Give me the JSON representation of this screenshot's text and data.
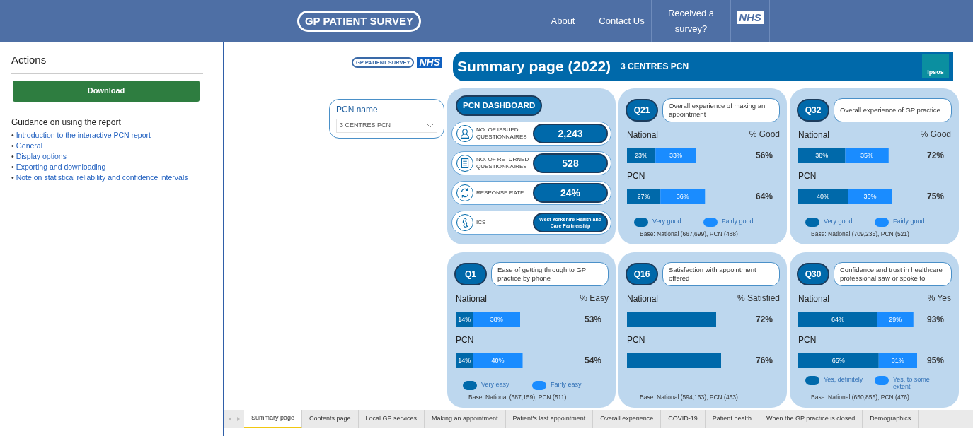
{
  "header": {
    "logo": "GP PATIENT SURVEY",
    "nav": [
      {
        "label": "About"
      },
      {
        "label": "Contact Us"
      },
      {
        "label": "Received a survey?"
      }
    ],
    "nhs_logo": "NHS"
  },
  "sidebar": {
    "title": "Actions",
    "download": "Download",
    "guidance_title": "Guidance on using the report",
    "links": [
      {
        "bullet": "•",
        "label": "Introduction to the interactive PCN report"
      },
      {
        "bullet": "•",
        "label": "General"
      },
      {
        "bullet": "•",
        "label": "Display options"
      },
      {
        "bullet": "•",
        "label": "Exporting and downloading"
      },
      {
        "bullet": "•",
        "label": "Note on statistical reliability and confidence intervals"
      }
    ]
  },
  "report": {
    "logo": "GP PATIENT SURVEY",
    "nhs_logo": "NHS",
    "title": "Summary page (2022)",
    "subtitle": "3 CENTRES PCN",
    "ipsos_logo": "Ipsos",
    "filter": {
      "label": "PCN name",
      "value": "3 CENTRES PCN"
    },
    "dashboard": {
      "title": "PCN DASHBOARD",
      "stats": [
        {
          "kind": "person",
          "label": "NO. OF ISSUED QUESTIONNAIRES",
          "value": "2,243"
        },
        {
          "kind": "document",
          "label": "NO. OF RETURNED QUESTIONNAIRES",
          "value": "528"
        },
        {
          "kind": "cycle",
          "label": "RESPONSE RATE",
          "value": "24%"
        },
        {
          "kind": "map",
          "label": "ICS",
          "value": "West Yorkshire Health and Care Partnership"
        }
      ]
    },
    "questions": [
      {
        "code": "Q21",
        "text": "Overall experience of making an appointment",
        "metric": "% Good",
        "totals": [
          "56%",
          "64%"
        ],
        "base": "Base: National (667,699), PCN (488)",
        "chart_data": {
          "type": "bar",
          "orientation": "horizontal",
          "stacked": true,
          "categories": [
            "National",
            "PCN"
          ],
          "series": [
            {
              "name": "Very good",
              "color": "#0069aa",
              "values": [
                23,
                27
              ],
              "value_labels": [
                "23%",
                "27%"
              ]
            },
            {
              "name": "Fairly good",
              "color": "#1a8cff",
              "values": [
                33,
                36
              ],
              "value_labels": [
                "33%",
                "36%"
              ]
            }
          ]
        }
      },
      {
        "code": "Q32",
        "text": "Overall experience of GP practice",
        "metric": "% Good",
        "totals": [
          "72%",
          "75%"
        ],
        "base": "Base: National (709,235), PCN (521)",
        "chart_data": {
          "type": "bar",
          "orientation": "horizontal",
          "stacked": true,
          "categories": [
            "National",
            "PCN"
          ],
          "series": [
            {
              "name": "Very good",
              "color": "#0069aa",
              "values": [
                38,
                40
              ],
              "value_labels": [
                "38%",
                "40%"
              ]
            },
            {
              "name": "Fairly good",
              "color": "#1a8cff",
              "values": [
                35,
                36
              ],
              "value_labels": [
                "35%",
                "36%"
              ]
            }
          ]
        }
      },
      {
        "code": "Q1",
        "text": "Ease of getting through to GP practice by phone",
        "metric": "% Easy",
        "totals": [
          "53%",
          "54%"
        ],
        "base": "Base: National (687,159), PCN (511)",
        "chart_data": {
          "type": "bar",
          "orientation": "horizontal",
          "stacked": true,
          "categories": [
            "National",
            "PCN"
          ],
          "series": [
            {
              "name": "Very easy",
              "color": "#0069aa",
              "values": [
                14,
                14
              ],
              "value_labels": [
                "14%",
                "14%"
              ]
            },
            {
              "name": "Fairly easy",
              "color": "#1a8cff",
              "values": [
                38,
                40
              ],
              "value_labels": [
                "38%",
                "40%"
              ]
            }
          ]
        }
      },
      {
        "code": "Q16",
        "text": "Satisfaction with appointment offered",
        "metric": "% Satisfied",
        "base": "Base: National (594,163), PCN (453)",
        "chart_data": {
          "type": "bar",
          "orientation": "horizontal",
          "stacked": true,
          "categories": [
            "National",
            "PCN"
          ],
          "series": [
            {
              "color": "#0069aa",
              "values": [
                72,
                76
              ],
              "value_labels": [
                "72%",
                "76%"
              ]
            }
          ]
        }
      },
      {
        "code": "Q30",
        "text": "Confidence and trust in healthcare professional saw or spoke to",
        "metric": "% Yes",
        "totals": [
          "93%",
          "95%"
        ],
        "base": "Base: National (650,855), PCN (476)",
        "chart_data": {
          "type": "bar",
          "orientation": "horizontal",
          "stacked": true,
          "categories": [
            "National",
            "PCN"
          ],
          "series": [
            {
              "name": "Yes, definitely",
              "color": "#0069aa",
              "values": [
                64,
                65
              ],
              "value_labels": [
                "64%",
                "65%"
              ]
            },
            {
              "name": "Yes, to some extent",
              "color": "#1a8cff",
              "values": [
                29,
                31
              ],
              "value_labels": [
                "29%",
                "31%"
              ]
            }
          ]
        }
      }
    ]
  },
  "tabs": [
    {
      "label": "Summary page",
      "selected": true
    },
    {
      "label": "Contents page",
      "selected": false
    },
    {
      "label": "Local GP services",
      "selected": false
    },
    {
      "label": "Making an appointment",
      "selected": false
    },
    {
      "label": "Patient's last appointment",
      "selected": false
    },
    {
      "label": "Overall experience",
      "selected": false
    },
    {
      "label": "COVID-19",
      "selected": false
    },
    {
      "label": "Patient health",
      "selected": false
    },
    {
      "label": "When the GP practice is closed",
      "selected": false
    },
    {
      "label": "Demographics",
      "selected": false
    }
  ]
}
